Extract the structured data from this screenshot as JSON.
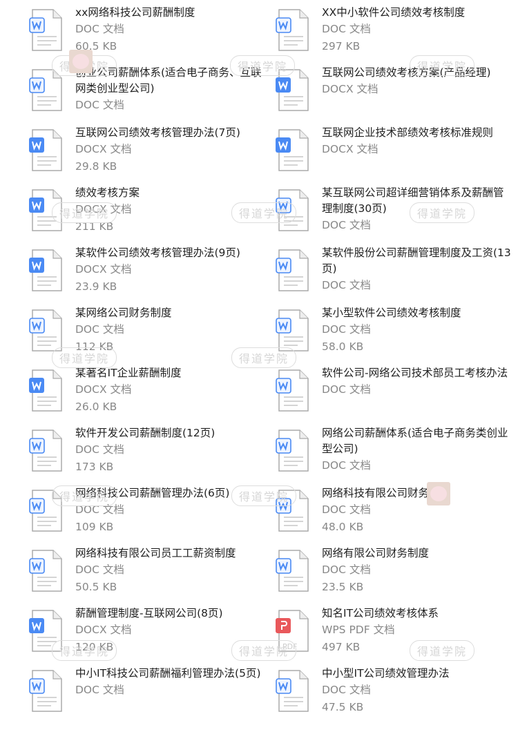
{
  "watermark": "得道学院",
  "colors": {
    "word": "#4a8af4",
    "pdf": "#e9585b"
  },
  "files": [
    {
      "title": "xx网络科技公司薪酬制度",
      "type": "DOC 文档",
      "size": "60.5 KB",
      "icon": "doc"
    },
    {
      "title": "XX中小软件公司绩效考核制度",
      "type": "DOC 文档",
      "size": "297 KB",
      "icon": "doc"
    },
    {
      "title": "创业公司薪酬体系(适合电子商务、互联网类创业型公司)",
      "type": "DOC 文档",
      "size": null,
      "icon": "doc"
    },
    {
      "title": "互联网公司绩效考核方案(产品经理)",
      "type": "DOCX 文档",
      "size": null,
      "icon": "docx"
    },
    {
      "title": "互联网公司绩效考核管理办法(7页)",
      "type": "DOCX 文档",
      "size": "29.8 KB",
      "icon": "docx"
    },
    {
      "title": "互联网企业技术部绩效考核标准规则",
      "type": "DOCX 文档",
      "size": null,
      "icon": "docx"
    },
    {
      "title": "绩效考核方案",
      "type": "DOCX 文档",
      "size": "211 KB",
      "icon": "docx"
    },
    {
      "title": "某互联网公司超详细营销体系及薪酬管理制度(30页)",
      "type": "DOC 文档",
      "size": null,
      "icon": "doc"
    },
    {
      "title": "某软件公司绩效考核管理办法(9页)",
      "type": "DOCX 文档",
      "size": "23.9 KB",
      "icon": "docx"
    },
    {
      "title": "某软件股份公司薪酬管理制度及工资(13页)",
      "type": "DOC 文档",
      "size": null,
      "icon": "doc"
    },
    {
      "title": "某网络公司财务制度",
      "type": "DOC 文档",
      "size": "112 KB",
      "icon": "doc"
    },
    {
      "title": "某小型软件公司绩效考核制度",
      "type": "DOC 文档",
      "size": "58.0 KB",
      "icon": "doc"
    },
    {
      "title": "某著名IT企业薪酬制度",
      "type": "DOCX 文档",
      "size": "26.0 KB",
      "icon": "docx"
    },
    {
      "title": "软件公司-网络公司技术部员工考核办法",
      "type": "DOC 文档",
      "size": null,
      "icon": "doc"
    },
    {
      "title": "软件开发公司薪酬制度(12页)",
      "type": "DOC 文档",
      "size": "173 KB",
      "icon": "doc"
    },
    {
      "title": "网络公司薪酬体系(适合电子商务类创业型公司)",
      "type": "DOC 文档",
      "size": null,
      "icon": "doc"
    },
    {
      "title": "网络科技公司薪酬管理办法(6页)",
      "type": "DOC 文档",
      "size": "109 KB",
      "icon": "doc"
    },
    {
      "title": "网络科技有限公司财务制度",
      "type": "DOC 文档",
      "size": "48.0 KB",
      "icon": "doc"
    },
    {
      "title": "网络科技有限公司员工工薪资制度",
      "type": "DOC 文档",
      "size": "50.5 KB",
      "icon": "doc"
    },
    {
      "title": "网络有限公司财务制度",
      "type": "DOC 文档",
      "size": "23.5 KB",
      "icon": "doc"
    },
    {
      "title": "薪酬管理制度-互联网公司(8页)",
      "type": "DOCX 文档",
      "size": "120 KB",
      "icon": "docx"
    },
    {
      "title": "知名IT公司绩效考核体系",
      "type": "WPS PDF 文档",
      "size": "497 KB",
      "icon": "pdf"
    },
    {
      "title": "中小IT科技公司薪酬福利管理办法(5页)",
      "type": "DOC 文档",
      "size": null,
      "icon": "doc"
    },
    {
      "title": "中小型IT公司绩效管理办法",
      "type": "DOC 文档",
      "size": "47.5 KB",
      "icon": "doc"
    }
  ]
}
